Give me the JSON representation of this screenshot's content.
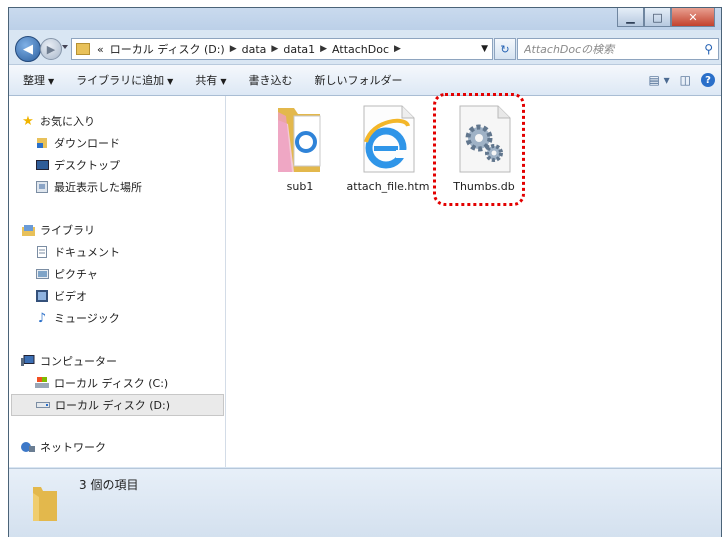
{
  "window": {
    "controls": {
      "minimize_icon": "minimize-icon",
      "maximize_icon": "maximize-icon",
      "close_icon": "close-icon"
    }
  },
  "address": {
    "crumbs": [
      "«",
      "ローカル ディスク (D:)",
      "data",
      "data1",
      "AttachDoc"
    ],
    "search_placeholder": "AttachDocの検索"
  },
  "toolbar": {
    "organize": "整理",
    "add_to_library": "ライブラリに追加",
    "share": "共有",
    "burn": "書き込む",
    "new_folder": "新しいフォルダー"
  },
  "nav": {
    "favorites": "お気に入り",
    "downloads": "ダウンロード",
    "desktop": "デスクトップ",
    "recent": "最近表示した場所",
    "libraries": "ライブラリ",
    "documents": "ドキュメント",
    "pictures": "ピクチャ",
    "videos": "ビデオ",
    "music": "ミュージック",
    "computer": "コンピューター",
    "drive_c": "ローカル ディスク (C:)",
    "drive_d": "ローカル ディスク (D:)",
    "network": "ネットワーク"
  },
  "files": [
    {
      "name": "sub1",
      "icon": "folder-icon"
    },
    {
      "name": "attach_file.htm",
      "icon": "internet-explorer-file-icon"
    },
    {
      "name": "Thumbs.db",
      "icon": "system-file-gears-icon"
    }
  ],
  "status": {
    "item_count": "3 個の項目"
  },
  "colors": {
    "highlight": "#e30000",
    "accent": "#2a6fc9"
  }
}
